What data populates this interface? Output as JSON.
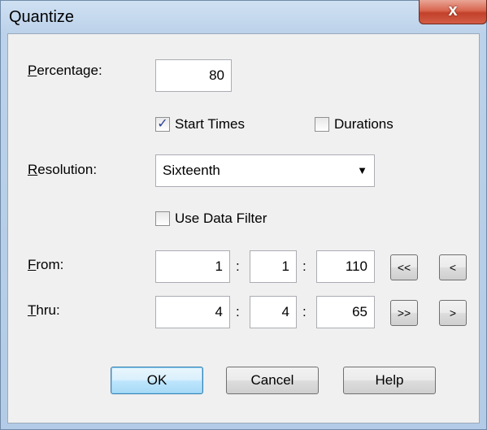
{
  "window": {
    "title": "Quantize",
    "close_glyph": "x"
  },
  "percentage": {
    "label_mnemonic": "P",
    "label_rest": "ercentage:",
    "value": "80"
  },
  "start_times": {
    "label": "Start Times",
    "checked": true
  },
  "durations": {
    "label": "Durations",
    "checked": false
  },
  "resolution": {
    "label_mnemonic": "R",
    "label_rest": "esolution:",
    "value": "Sixteenth",
    "arrow": "▼"
  },
  "use_data_filter": {
    "label": "Use Data Filter",
    "checked": false
  },
  "from": {
    "label_mnemonic": "F",
    "label_rest": "rom:",
    "measure": "1",
    "beat": "1",
    "tick": "110",
    "first_button": "<<",
    "prev_button": "<"
  },
  "thru": {
    "label_mnemonic": "T",
    "label_rest": "hru:",
    "measure": "4",
    "beat": "4",
    "tick": "65",
    "last_button": ">>",
    "next_button": ">"
  },
  "separator": ":",
  "buttons": {
    "ok": "OK",
    "cancel": "Cancel",
    "help": "Help"
  },
  "icons": {
    "check": "checkmark-icon",
    "close": "close-icon"
  }
}
